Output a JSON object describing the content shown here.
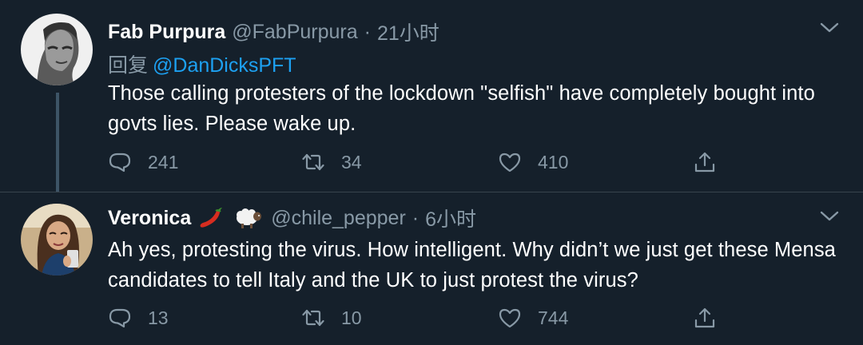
{
  "tweets": [
    {
      "display_name": "Fab Purpura",
      "handle": "@FabPurpura",
      "separator": "·",
      "time": "21小时",
      "reply_prefix": "回复",
      "reply_mention": "@DanDicksPFT",
      "text": "Those calling protesters of the lockdown \"selfish\" have completely bought into govts lies. Please wake up.",
      "stats": {
        "replies": "241",
        "retweets": "34",
        "likes": "410"
      }
    },
    {
      "display_name": "Veronica",
      "name_emojis": [
        "chili-pepper-emoji",
        "sheep-emoji"
      ],
      "handle": "@chile_pepper",
      "separator": "·",
      "time": "6小时",
      "text": "Ah yes, protesting the virus. How intelligent. Why didn’t we just get these Mensa candidates to tell Italy and the UK to just protest the virus?",
      "stats": {
        "replies": "13",
        "retweets": "10",
        "likes": "744"
      }
    }
  ],
  "colors": {
    "background": "#15202b",
    "text_primary": "#ffffff",
    "text_secondary": "#8899a6",
    "link": "#1da1f2",
    "divider": "#38444d",
    "thread_line": "#3d5466"
  },
  "icons": {
    "reply": "reply-icon",
    "retweet": "retweet-icon",
    "like": "heart-icon",
    "share": "share-icon",
    "more": "chevron-down-icon"
  }
}
